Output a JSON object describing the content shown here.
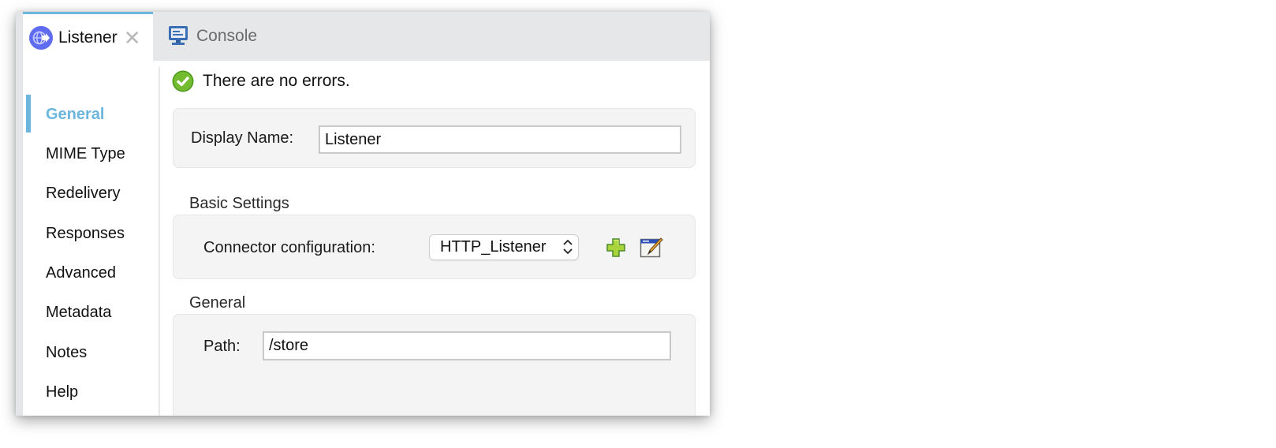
{
  "tabs": [
    {
      "label": "Listener",
      "icon": "listener-globe-icon",
      "active": true,
      "closable": true
    },
    {
      "label": "Console",
      "icon": "console-monitor-icon",
      "active": false
    }
  ],
  "sidebar": {
    "items": [
      {
        "label": "General",
        "active": true
      },
      {
        "label": "MIME Type"
      },
      {
        "label": "Redelivery"
      },
      {
        "label": "Responses"
      },
      {
        "label": "Advanced"
      },
      {
        "label": "Metadata"
      },
      {
        "label": "Notes"
      },
      {
        "label": "Help"
      }
    ]
  },
  "status": {
    "text": "There are no errors.",
    "icon": "check-circle-icon"
  },
  "display_name": {
    "label": "Display Name:",
    "value": "Listener"
  },
  "basic_settings": {
    "title": "Basic Settings",
    "connector_label": "Connector configuration:",
    "connector_value": "HTTP_Listener",
    "add_icon": "add-plus-icon",
    "edit_icon": "edit-config-icon"
  },
  "general_section": {
    "title": "General",
    "path_label": "Path:",
    "path_value": "/store"
  },
  "colors": {
    "accent": "#6cb6dd",
    "ok_green": "#6fb52c",
    "listener_icon": "#5f6bf0"
  }
}
